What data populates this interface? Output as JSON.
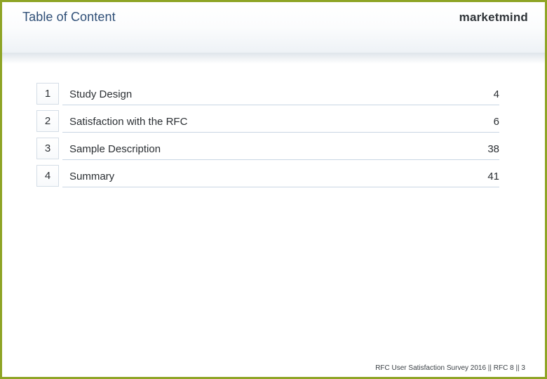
{
  "header": {
    "title": "Table of Content",
    "logo_text": "marketmind"
  },
  "toc": {
    "items": [
      {
        "number": "1",
        "title": "Study Design",
        "page": "4"
      },
      {
        "number": "2",
        "title": "Satisfaction with the RFC",
        "page": "6"
      },
      {
        "number": "3",
        "title": "Sample Description",
        "page": "38"
      },
      {
        "number": "4",
        "title": "Summary",
        "page": "41"
      }
    ]
  },
  "footer": {
    "text": "RFC User Satisfaction Survey 2016 || RFC 8 || 3"
  },
  "colors": {
    "border_accent": "#8ea425",
    "title_blue": "#2f4f77",
    "rule_blue": "#c8d5e3",
    "box_border": "#d4dde6",
    "text_dark": "#2b2f33"
  }
}
